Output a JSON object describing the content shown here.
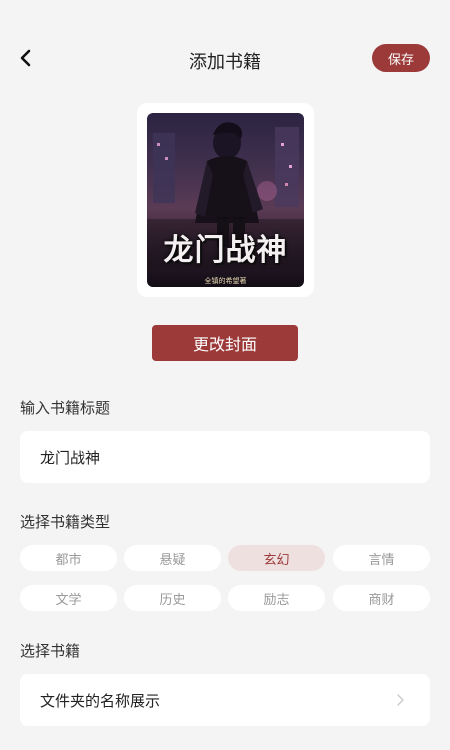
{
  "header": {
    "title": "添加书籍",
    "save_label": "保存"
  },
  "cover": {
    "title_text": "龙门战神",
    "author_text": "全镇的希望著"
  },
  "change_cover_label": "更改封面",
  "title_section": {
    "label": "输入书籍标题",
    "value": "龙门战神"
  },
  "type_section": {
    "label": "选择书籍类型",
    "tags": [
      "都市",
      "悬疑",
      "玄幻",
      "言情",
      "文学",
      "历史",
      "励志",
      "商财"
    ],
    "selected": "玄幻"
  },
  "book_section": {
    "label": "选择书籍",
    "value": "文件夹的名称展示"
  },
  "colors": {
    "accent": "#9b3a39",
    "selected_tag_bg": "#eee0df",
    "background": "#f4f4f4"
  }
}
